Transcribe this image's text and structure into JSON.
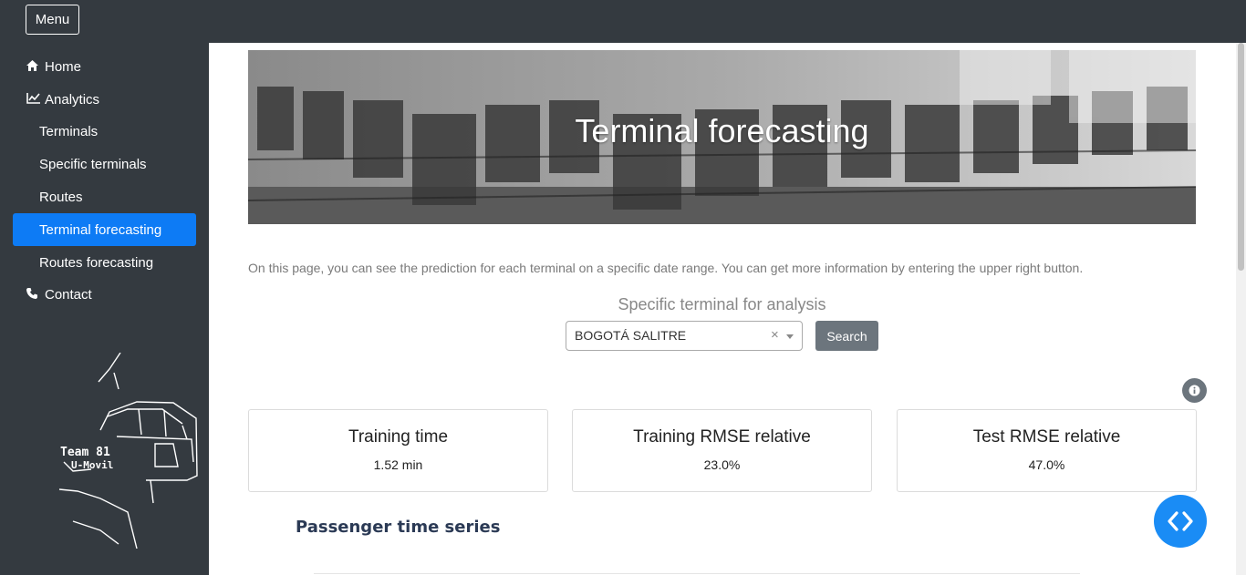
{
  "topbar": {
    "menu_label": "Menu"
  },
  "sidebar": {
    "items": [
      {
        "label": "Home",
        "icon": "home-icon"
      },
      {
        "label": "Analytics",
        "icon": "chart-line-icon"
      },
      {
        "label": "Terminals"
      },
      {
        "label": "Specific terminals"
      },
      {
        "label": "Routes"
      },
      {
        "label": "Terminal forecasting",
        "active": true
      },
      {
        "label": "Routes forecasting"
      },
      {
        "label": "Contact",
        "icon": "phone-icon"
      }
    ],
    "logo": {
      "line1": "Team 81",
      "line2": "U-Movil"
    }
  },
  "banner": {
    "title": "Terminal forecasting"
  },
  "intro": "On this page, you can see the prediction for each terminal on a specific date range. You can get more information by entering the upper right button.",
  "selector": {
    "label": "Specific terminal for analysis",
    "value": "BOGOTÁ SALITRE",
    "clear": "×",
    "button": "Search"
  },
  "cards": [
    {
      "title": "Training time",
      "value": "1.52 min"
    },
    {
      "title": "Training RMSE relative",
      "value": "23.0%"
    },
    {
      "title": "Test RMSE relative",
      "value": "47.0%"
    }
  ],
  "timeseries": {
    "title": "Passenger time series"
  },
  "colors": {
    "accent": "#0d7bf5",
    "sidebar": "#343a40",
    "fab": "#1a8cf5",
    "secondary": "#6c757d"
  }
}
